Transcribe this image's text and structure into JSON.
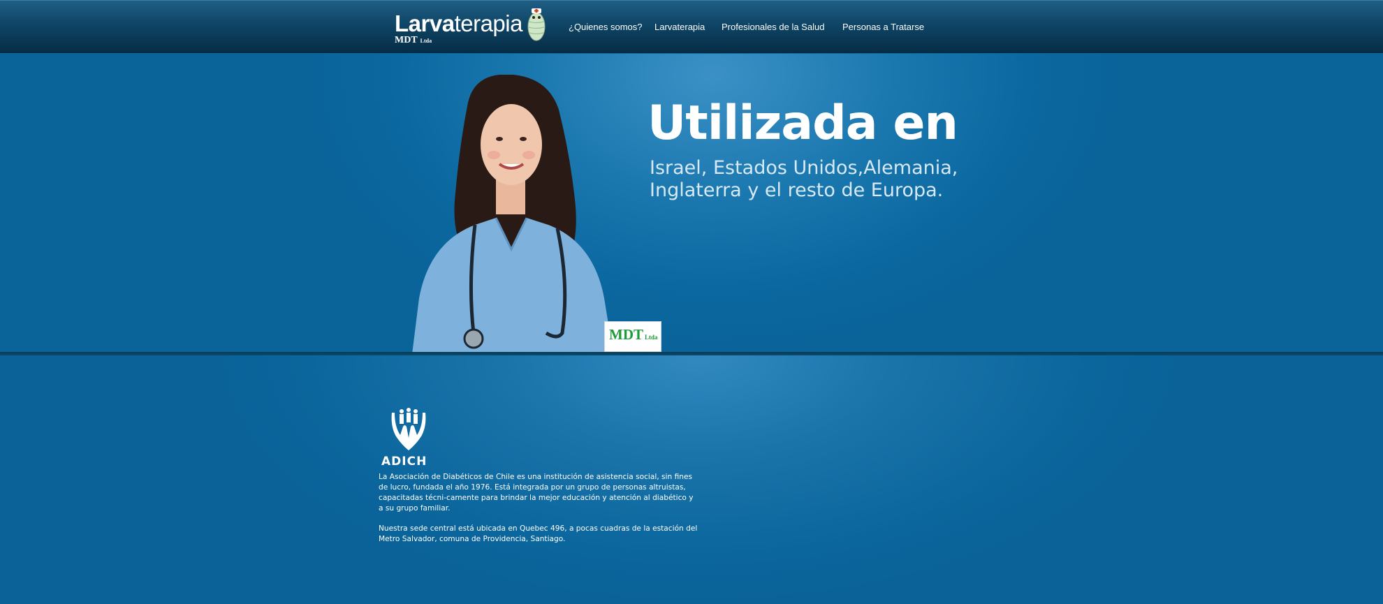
{
  "header": {
    "logo_bold": "Larva",
    "logo_light": "terapia",
    "logo_sub": "MDT",
    "logo_sub_small": "Ltda",
    "nav": [
      {
        "label": "¿Quienes somos?"
      },
      {
        "label": "Larvaterapia"
      },
      {
        "label": "Profesionales de la Salud"
      },
      {
        "label": "Personas a Tratarse"
      }
    ]
  },
  "hero": {
    "title": "Utilizada en",
    "subtitle_line1": "Israel, Estados Unidos,Alemania,",
    "subtitle_line2": "Inglaterra y el resto de Europa.",
    "badge_text": "MDT",
    "badge_small": "Ltda"
  },
  "about": {
    "logo_text": "ADICH",
    "paragraph1": "La Asociación de Diabéticos de Chile es una institución de asistencia social, sin fines de lucro, fundada el año 1976. Está integrada por un grupo de personas altruistas, capacitadas técni-camente para brindar la mejor educación y atención al diabético y a su grupo familiar.",
    "paragraph2": "Nuestra sede central está ubicada en Quebec 496, a pocas cuadras de la estación del Metro Salvador, comuna de Providencia, Santiago."
  },
  "colors": {
    "nav_bg": "#0f4566",
    "hero_bg": "#1c79b0",
    "badge_green": "#1d9a3a",
    "text": "#ffffff"
  }
}
